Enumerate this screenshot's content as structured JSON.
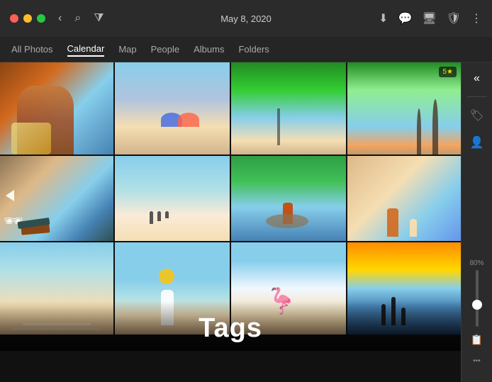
{
  "titlebar": {
    "date": "May 8, 2020"
  },
  "nav": {
    "items": [
      {
        "id": "all-photos",
        "label": "All Photos",
        "active": false
      },
      {
        "id": "calendar",
        "label": "Calendar",
        "active": true
      },
      {
        "id": "map",
        "label": "Map",
        "active": false
      },
      {
        "id": "people",
        "label": "People",
        "active": false
      },
      {
        "id": "albums",
        "label": "Albums",
        "active": false
      },
      {
        "id": "folders",
        "label": "Folders",
        "active": false
      }
    ]
  },
  "photos": [
    {
      "id": "p1",
      "class": "p1",
      "cell": "r1-c1"
    },
    {
      "id": "p2",
      "class": "p2",
      "cell": "r1-c2"
    },
    {
      "id": "p3",
      "class": "p3",
      "cell": "r1-c3"
    },
    {
      "id": "p4",
      "class": "p4",
      "cell": "r1-c4",
      "badge": "5★"
    },
    {
      "id": "p5",
      "class": "p5",
      "cell": "r2-c1"
    },
    {
      "id": "p6",
      "class": "p6",
      "cell": "r2-c2"
    },
    {
      "id": "p7",
      "class": "p7",
      "cell": "r2-c3"
    },
    {
      "id": "p8",
      "class": "p8",
      "cell": "r2-c4"
    },
    {
      "id": "p9",
      "class": "p9",
      "cell": "r3-c1"
    },
    {
      "id": "p10",
      "class": "p10",
      "cell": "r3-c2"
    },
    {
      "id": "p11",
      "class": "p11",
      "cell": "r3-c3"
    },
    {
      "id": "p12",
      "class": "p12",
      "cell": "r3-c4"
    }
  ],
  "tags_label": "Tags",
  "zoom_percent": "80%",
  "sidebar": {
    "icons": [
      {
        "name": "collapse-icon",
        "symbol": "«"
      },
      {
        "name": "tag-icon",
        "symbol": "🏷"
      },
      {
        "name": "people-icon",
        "symbol": "👤"
      },
      {
        "name": "clipboard-icon",
        "symbol": "📋"
      },
      {
        "name": "more-icon",
        "symbol": "•••"
      }
    ]
  }
}
